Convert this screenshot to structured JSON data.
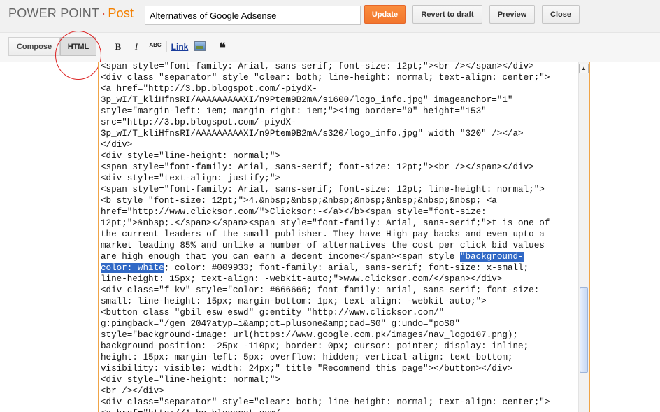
{
  "header": {
    "brand": "POWER POINT",
    "brand_separator": "·",
    "brand_section": "Post",
    "title_value": "Alternatives of Google Adsense",
    "update_label": "Update",
    "revert_label": "Revert to draft",
    "preview_label": "Preview",
    "close_label": "Close"
  },
  "toolbar": {
    "compose_label": "Compose",
    "html_label": "HTML",
    "bold_glyph": "B",
    "italic_glyph": "I",
    "spellcheck_glyph": "ABC",
    "link_label": "Link",
    "quote_glyph": "❝",
    "icons": [
      "bold-icon",
      "italic-icon",
      "spellcheck-icon",
      "link-icon",
      "image-icon",
      "quote-icon"
    ]
  },
  "editor": {
    "code_before": "<span style=\"font-family: Arial, sans-serif; font-size: 12pt;\"><br /></span></div>\n<div class=\"separator\" style=\"clear: both; line-height: normal; text-align: center;\">\n<a href=\"http://3.bp.blogspot.com/-piydX-\n3p_wI/T_kliHfnsRI/AAAAAAAAAXI/n9Ptem9B2mA/s1600/logo_info.jpg\" imageanchor=\"1\"\nstyle=\"margin-left: 1em; margin-right: 1em;\"><img border=\"0\" height=\"153\"\nsrc=\"http://3.bp.blogspot.com/-piydX-\n3p_wI/T_kliHfnsRI/AAAAAAAAAXI/n9Ptem9B2mA/s320/logo_info.jpg\" width=\"320\" /></a>\n</div>\n<div style=\"line-height: normal;\">\n<span style=\"font-family: Arial, sans-serif; font-size: 12pt;\"><br /></span></div>\n<div style=\"text-align: justify;\">\n<span style=\"font-family: Arial, sans-serif; font-size: 12pt; line-height: normal;\">\n<b style=\"font-size: 12pt;\">4.&nbsp;&nbsp;&nbsp;&nbsp;&nbsp;&nbsp;&nbsp; <a\nhref=\"http://www.clicksor.com/\">Clicksor:-</a></b><span style=\"font-size:\n12pt;\">&nbsp;.</span></span><span style=\"font-family: Arial, sans-serif;\">t is one of\nthe current leaders of the small publisher. They have High pay backs and even upto a\nmarket leading 85% and unlike a number of alternatives the cost per click bid values\nare high enough that you can earn a decent income</span><span style=",
    "code_highlight": "\"background-\ncolor: white",
    "code_after": "; color: #009933; font-family: arial, sans-serif; font-size: x-small;\nline-height: 15px; text-align: -webkit-auto;\">www.clicksor.com/</span></div>\n<div class=\"f kv\" style=\"color: #666666; font-family: arial, sans-serif; font-size:\nsmall; line-height: 15px; margin-bottom: 1px; text-align: -webkit-auto;\">\n<button class=\"gbil esw eswd\" g:entity=\"http://www.clicksor.com/\"\ng:pingback=\"/gen_204?atyp=i&amp;ct=plusone&amp;cad=S0\" g:undo=\"poS0\"\nstyle=\"background-image: url(https://www.google.com.pk/images/nav_logo107.png);\nbackground-position: -25px -110px; border: 0px; cursor: pointer; display: inline;\nheight: 15px; margin-left: 5px; overflow: hidden; vertical-align: text-bottom;\nvisibility: visible; width: 24px;\" title=\"Recommend this page\"></button></div>\n<div style=\"line-height: normal;\">\n<br /></div>\n<div class=\"separator\" style=\"clear: both; line-height: normal; text-align: center;\">\n<a href=\"http://1.bp.blogspot.com/"
  },
  "colors": {
    "accent_orange": "#f48000",
    "update_button": "#f57b2f",
    "selection": "#3169c6",
    "annotation_circle": "#dd2222"
  }
}
